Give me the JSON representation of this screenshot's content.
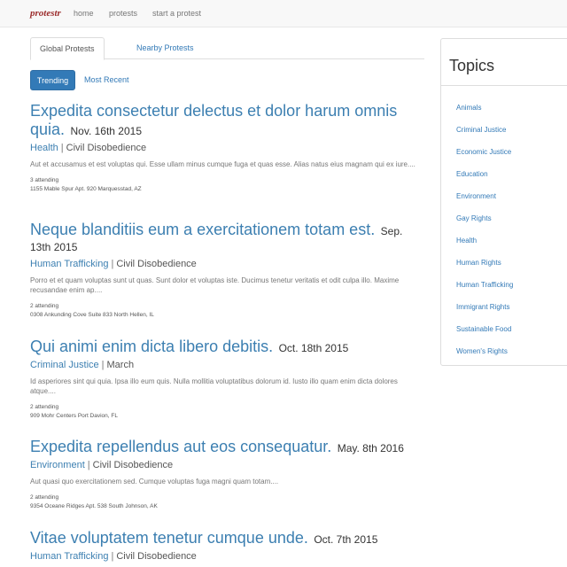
{
  "nav": {
    "brand": "protestr",
    "links": [
      "home",
      "protests",
      "start a protest"
    ]
  },
  "tabs": [
    "Global Protests",
    "Nearby Protests"
  ],
  "filters": [
    "Trending",
    "Most Recent"
  ],
  "protests": [
    {
      "title": "Expedita consectetur delectus et dolor harum omnis quia.",
      "date": "Nov. 16th 2015",
      "category": "Health",
      "type": "Civil Disobedience",
      "description": "Aut et accusamus et est voluptas qui. Esse ullam minus cumque fuga et quas esse. Alias natus eius magnam qui ex iure....",
      "attending": "3 attending",
      "address": "1155 Mable Spur Apt. 920 Marquesstad, AZ"
    },
    {
      "title": "Neque blanditiis eum a exercitationem totam est.",
      "date": "Sep. 13th 2015",
      "category": "Human Trafficking",
      "type": "Civil Disobedience",
      "description": "Porro et et quam voluptas sunt ut quas. Sunt dolor et voluptas iste. Ducimus tenetur veritatis et odit culpa illo. Maxime recusandae enim ap....",
      "attending": "2 attending",
      "address": "0308 Ankunding Cove Suite 833 North Hellen, IL"
    },
    {
      "title": "Qui animi enim dicta libero debitis.",
      "date": "Oct. 18th 2015",
      "category": "Criminal Justice",
      "type": "March",
      "description": "Id asperiores sint qui quia. Ipsa illo eum quis. Nulla mollitia voluptatibus dolorum id. Iusto illo quam enim dicta dolores atque....",
      "attending": "2 attending",
      "address": "909 Mohr Centers Port Davion, FL"
    },
    {
      "title": "Expedita repellendus aut eos consequatur.",
      "date": "May. 8th 2016",
      "category": "Environment",
      "type": "Civil Disobedience",
      "description": "Aut quasi quo exercitationem sed. Cumque voluptas fuga magni quam totam....",
      "attending": "2 attending",
      "address": "9354 Oceane Ridges Apt. 538 South Johnson, AK"
    },
    {
      "title": "Vitae voluptatem tenetur cumque unde.",
      "date": "Oct. 7th 2015",
      "category": "Human Trafficking",
      "type": "Civil Disobedience"
    }
  ],
  "sidebar": {
    "title": "Topics",
    "topics": [
      "Animals",
      "Criminal Justice",
      "Economic Justice",
      "Education",
      "Environment",
      "Gay Rights",
      "Health",
      "Human Rights",
      "Human Trafficking",
      "Immigrant Rights",
      "Sustainable Food",
      "Women's Rights"
    ]
  }
}
